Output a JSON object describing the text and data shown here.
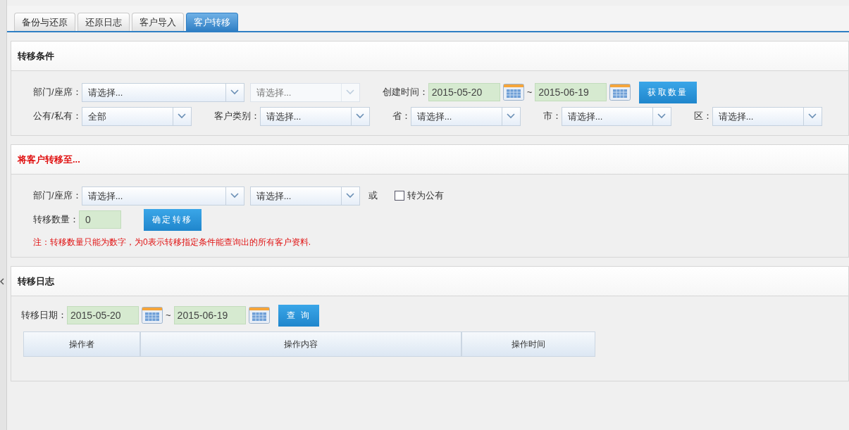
{
  "tabs": [
    {
      "label": "备份与还原",
      "selected": false
    },
    {
      "label": "还原日志",
      "selected": false
    },
    {
      "label": "客户导入",
      "selected": false
    },
    {
      "label": "客户转移",
      "selected": true
    }
  ],
  "sections": [
    {
      "title": "转移条件",
      "alert": false,
      "rows": [
        {
          "items": [
            {
              "kind": "label",
              "text": "部门/座席："
            },
            {
              "kind": "select",
              "value": "请选择...",
              "disabled": false
            },
            {
              "kind": "select",
              "value": "请选择...",
              "disabled": true
            },
            {
              "kind": "label",
              "text": "创建时间："
            },
            {
              "kind": "date",
              "value": "2015-05-20"
            },
            {
              "kind": "text",
              "text": "~"
            },
            {
              "kind": "date",
              "value": "2015-06-19"
            },
            {
              "kind": "button",
              "text": "获取数量"
            }
          ]
        },
        {
          "items": [
            {
              "kind": "label",
              "text": "公有/私有："
            },
            {
              "kind": "select",
              "value": "全部",
              "disabled": false
            },
            {
              "kind": "label",
              "text": "客户类别："
            },
            {
              "kind": "select",
              "value": "请选择...",
              "disabled": false
            },
            {
              "kind": "label",
              "text": "省："
            },
            {
              "kind": "select",
              "value": "请选择...",
              "disabled": false
            },
            {
              "kind": "label",
              "text": "市："
            },
            {
              "kind": "select",
              "value": "请选择...",
              "disabled": false
            },
            {
              "kind": "label",
              "text": "区："
            },
            {
              "kind": "select",
              "value": "请选择...",
              "disabled": false
            }
          ]
        }
      ]
    },
    {
      "title": "将客户转移至...",
      "alert": true,
      "rows": [
        {
          "items": [
            {
              "kind": "label",
              "text": "部门/座席："
            },
            {
              "kind": "select",
              "value": "请选择...",
              "disabled": false
            },
            {
              "kind": "select",
              "value": "请选择...",
              "disabled": false
            },
            {
              "kind": "text",
              "text": "或"
            },
            {
              "kind": "checkbox",
              "text": "转为公有",
              "checked": false
            }
          ]
        },
        {
          "items": [
            {
              "kind": "label",
              "text": "转移数量："
            },
            {
              "kind": "input",
              "value": "0"
            },
            {
              "kind": "button",
              "text": "确定转移"
            }
          ]
        }
      ],
      "note": "注：转移数量只能为数字，为0表示转移指定条件能查询出的所有客户资料."
    },
    {
      "title": "转移日志",
      "alert": false,
      "rows": [
        {
          "items": [
            {
              "kind": "label",
              "text": "转移日期："
            },
            {
              "kind": "date",
              "value": "2015-05-20"
            },
            {
              "kind": "text",
              "text": "~"
            },
            {
              "kind": "date",
              "value": "2015-06-19"
            },
            {
              "kind": "button",
              "text": "查 询"
            }
          ]
        }
      ],
      "table": {
        "columns": [
          "操作者",
          "操作内容",
          "操作时间"
        ]
      }
    }
  ]
}
